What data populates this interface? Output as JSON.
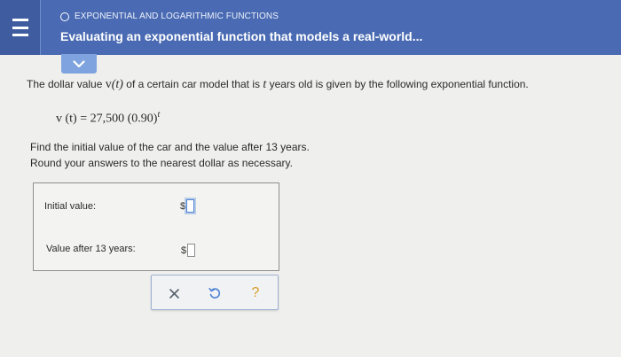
{
  "header": {
    "section": "EXPONENTIAL AND LOGARITHMIC FUNCTIONS",
    "title": "Evaluating an exponential function that models a real-world...",
    "menu_icon": "hamburger-icon",
    "dropdown_icon": "chevron-down-icon"
  },
  "problem": {
    "intro_before": "The dollar value ",
    "function_v": "v",
    "t_arg": "(t)",
    "intro_mid": " of a certain car model that is ",
    "t_var": "t",
    "intro_after": " years old is given by the following exponential function.",
    "formula_lhs": "v (t) = 27,500 (0.90)",
    "formula_exp": "t",
    "instruction_line1": "Find the initial value of the car and the value after 13 years.",
    "instruction_line2": "Round your answers to the nearest dollar as necessary."
  },
  "answers": {
    "initial_label": "Initial value:",
    "initial_currency": "$",
    "initial_value": "",
    "after_label": "Value after 13 years:",
    "after_currency": "$",
    "after_value": ""
  },
  "actions": {
    "clear_icon": "x-icon",
    "undo_icon": "undo-icon",
    "help_label": "?"
  },
  "colors": {
    "header_bg": "#4a6bb3",
    "menu_bg": "#3e5c9f",
    "dropdown_bg": "#7fa3de",
    "page_bg": "#efefed",
    "help_color": "#d59c21",
    "focus_color": "#4d83d4"
  }
}
